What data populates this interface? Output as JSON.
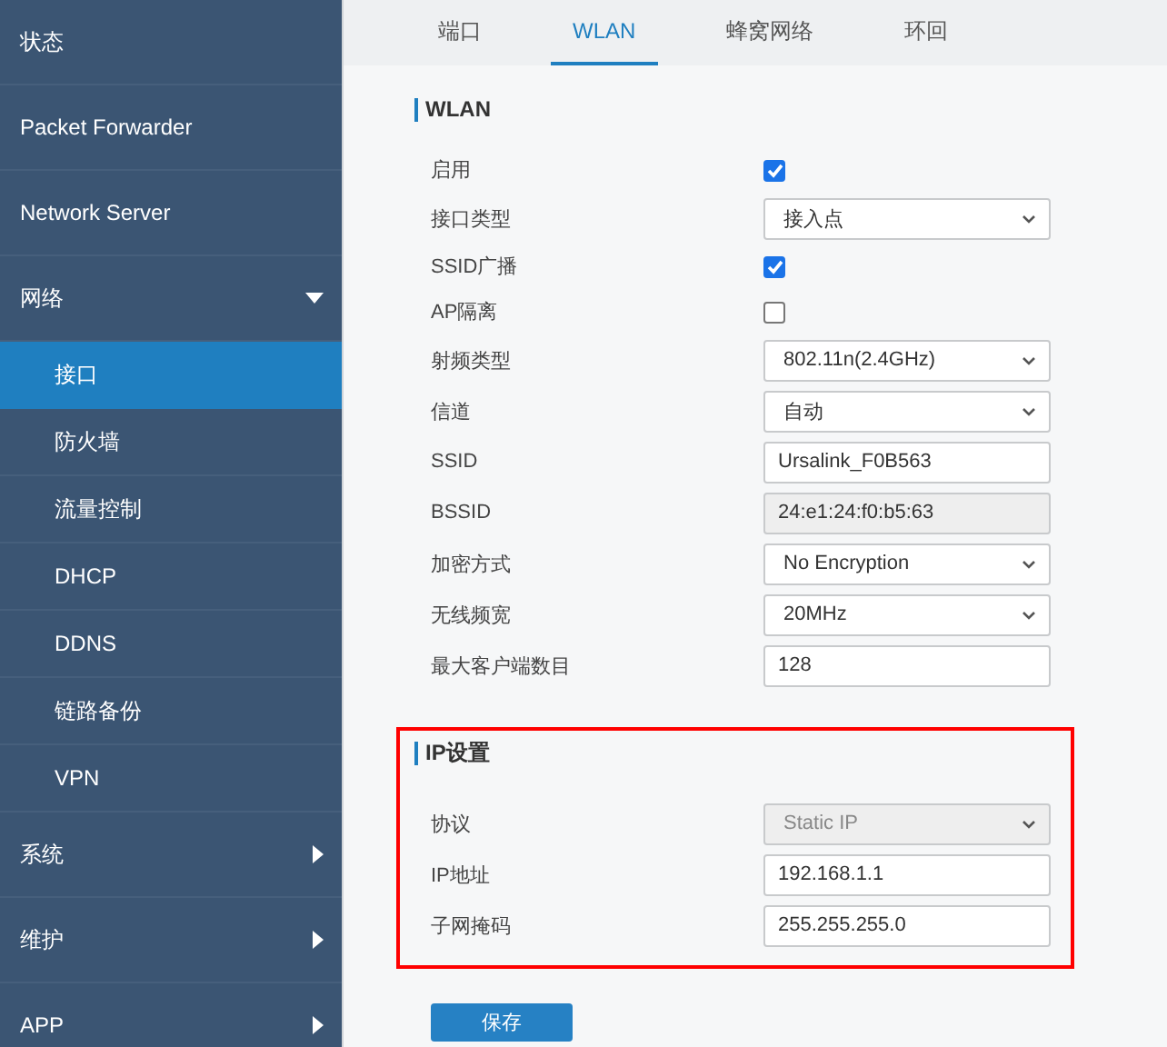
{
  "sidebar": {
    "items": [
      {
        "label": "状态",
        "kind": "link",
        "selected": false
      },
      {
        "label": "Packet Forwarder",
        "kind": "link",
        "selected": false
      },
      {
        "label": "Network Server",
        "kind": "link",
        "selected": false
      },
      {
        "label": "网络",
        "kind": "group",
        "selected": false,
        "expanded": true,
        "children": [
          {
            "label": "接口",
            "selected": true
          },
          {
            "label": "防火墙",
            "selected": false
          },
          {
            "label": "流量控制",
            "selected": false
          },
          {
            "label": "DHCP",
            "selected": false
          },
          {
            "label": "DDNS",
            "selected": false
          },
          {
            "label": "链路备份",
            "selected": false
          },
          {
            "label": "VPN",
            "selected": false
          }
        ]
      },
      {
        "label": "系统",
        "kind": "group",
        "selected": false,
        "expanded": false
      },
      {
        "label": "维护",
        "kind": "group",
        "selected": false,
        "expanded": false
      },
      {
        "label": "APP",
        "kind": "group",
        "selected": false,
        "expanded": false
      }
    ]
  },
  "tabs": [
    {
      "label": "端口",
      "selected": false
    },
    {
      "label": "WLAN",
      "selected": true
    },
    {
      "label": "蜂窝网络",
      "selected": false
    },
    {
      "label": "环回",
      "selected": false
    }
  ],
  "sections": [
    {
      "title": "WLAN",
      "highlighted": false,
      "fields": [
        {
          "label": "启用",
          "kind": "checkbox",
          "checked": true
        },
        {
          "label": "接口类型",
          "kind": "select",
          "value": "接入点",
          "disabled": false
        },
        {
          "label": "SSID广播",
          "kind": "checkbox",
          "checked": true
        },
        {
          "label": "AP隔离",
          "kind": "checkbox",
          "checked": false
        },
        {
          "label": "射频类型",
          "kind": "select",
          "value": "802.11n(2.4GHz)",
          "disabled": false
        },
        {
          "label": "信道",
          "kind": "select",
          "value": "自动",
          "disabled": false
        },
        {
          "label": "SSID",
          "kind": "text",
          "value": "Ursalink_F0B563",
          "disabled": false
        },
        {
          "label": "BSSID",
          "kind": "text",
          "value": "24:e1:24:f0:b5:63",
          "disabled": true
        },
        {
          "label": "加密方式",
          "kind": "select",
          "value": "No Encryption",
          "disabled": false
        },
        {
          "label": "无线频宽",
          "kind": "select",
          "value": "20MHz",
          "disabled": false
        },
        {
          "label": "最大客户端数目",
          "kind": "text",
          "value": "128",
          "disabled": false
        }
      ]
    },
    {
      "title": "IP设置",
      "highlighted": true,
      "fields": [
        {
          "label": "协议",
          "kind": "select",
          "value": "Static IP",
          "disabled": true
        },
        {
          "label": "IP地址",
          "kind": "text",
          "value": "192.168.1.1",
          "disabled": false
        },
        {
          "label": "子网掩码",
          "kind": "text",
          "value": "255.255.255.0",
          "disabled": false
        }
      ]
    }
  ],
  "save_button": "保存"
}
